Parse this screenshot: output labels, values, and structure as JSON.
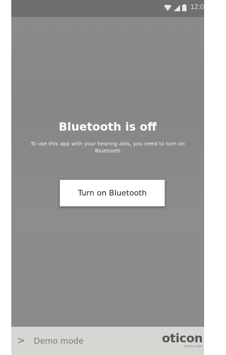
{
  "status_bar": {
    "time": "12:0",
    "icons": [
      "wifi-icon",
      "signal-icon",
      "battery-icon"
    ]
  },
  "dialog": {
    "title": "Bluetooth is off",
    "description": "To use this app with your hearing aids, you need to turn on Bluetooth",
    "button_label": "Turn on Bluetooth"
  },
  "bottom_bar": {
    "demo_chevron": ">",
    "demo_label": "Demo mode",
    "brand_name": "oticon",
    "brand_tagline": "PEOPLE FIRST"
  },
  "colors": {
    "overlay": "#8a8a8a",
    "status_bar": "#6f6f6f",
    "bottom_bar": "#d8d6d3",
    "button_bg": "#ffffff"
  }
}
